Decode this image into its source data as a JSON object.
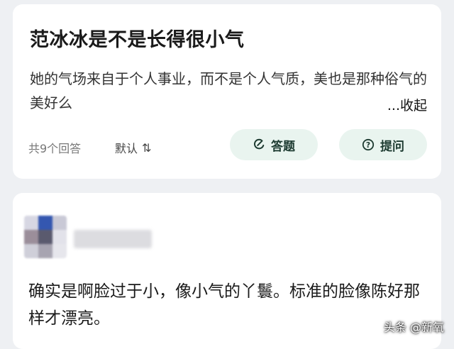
{
  "question": {
    "title": "范冰冰是不是长得很小气",
    "description": "她的气场来自于个人事业，而不是个人气质，美也是那种俗气的美好么",
    "collapse_label": "...收起",
    "answer_count": "共9个回答",
    "sort_label": "默认",
    "sort_icon": "⇅",
    "answer_button": "答题",
    "ask_button": "提问",
    "accent_color": "#e9f4ef"
  },
  "answer": {
    "text": "确实是啊脸过于小，像小气的丫鬟。标准的脸像陈好那样才漂亮。"
  },
  "watermark": "头条 @新氧"
}
